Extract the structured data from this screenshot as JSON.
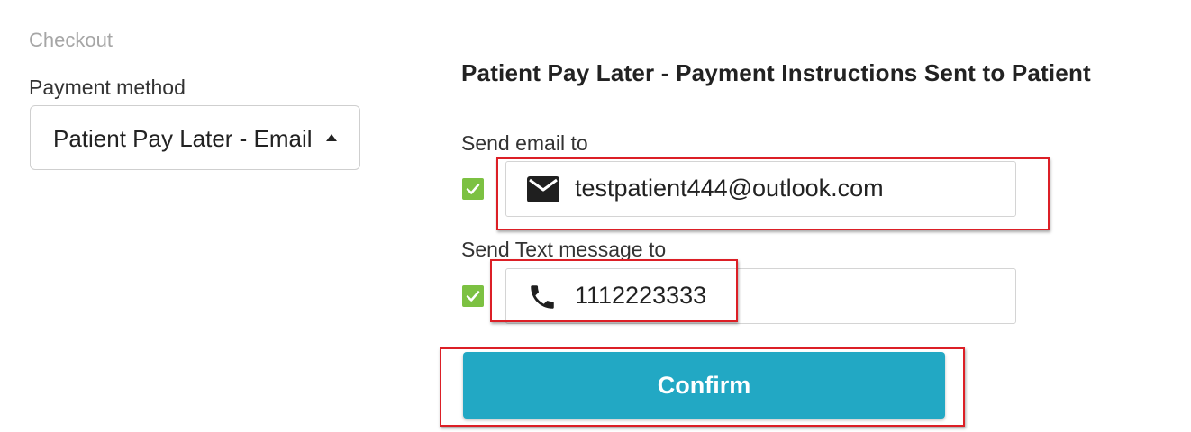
{
  "checkout": {
    "title": "Checkout",
    "payment_method_label": "Payment method",
    "payment_method_value": "Patient Pay Later - Email"
  },
  "panel": {
    "heading": "Patient Pay Later - Payment Instructions Sent to Patient",
    "email": {
      "label": "Send email to",
      "checked": true,
      "icon": "envelope-icon",
      "value": "testpatient444@outlook.com"
    },
    "text": {
      "label": "Send Text message to",
      "checked": true,
      "icon": "phone-icon",
      "value": "1112223333"
    },
    "confirm_label": "Confirm"
  },
  "colors": {
    "accent": "#22a8c4",
    "checkbox": "#7cc142",
    "highlight": "#dc1f26"
  }
}
